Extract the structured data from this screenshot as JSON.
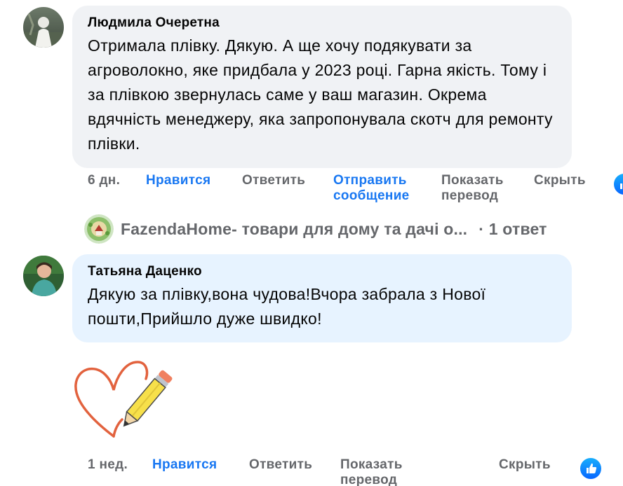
{
  "comments": [
    {
      "author": "Людмила Очеретна",
      "text": "Отримала плівку. Дякую. А ще хочу подякувати за агроволокно, яке придбала у 2023 році. Гарна якість. Тому і за плівкою звернулась саме у ваш магазин. Окрема вдячність менеджеру, яка запропонувала скотч для ремонту плівки.",
      "actions": {
        "time": "6 дн.",
        "like": "Нравится",
        "reply": "Ответить",
        "message_line1": "Отправить",
        "message_line2": "сообщение",
        "translate_line1": "Показать",
        "translate_line2": "перевод",
        "hide": "Скрыть"
      }
    },
    {
      "author": "Татьяна Даценко",
      "text": "Дякую за плівку,вона чудова!Вчора забрала з Нової пошти,Прийшло дуже швидко!",
      "actions": {
        "time": "1 нед.",
        "like": "Нравится",
        "reply": "Ответить",
        "translate_line1": "Показать",
        "translate_line2": "перевод",
        "hide": "Скрыть"
      }
    }
  ],
  "reply_preview": {
    "page_name": "FazendaHome- товари для дому та дачі о...",
    "count": "· 1 ответ"
  },
  "icons": {
    "like_badge": "thumbs-up-icon",
    "sticker": "heart-pencil-sticker"
  },
  "colors": {
    "link_blue": "#1877f2",
    "muted_grey": "#65676b",
    "bubble_grey": "#f0f2f5",
    "bubble_blue": "#e7f3ff"
  }
}
